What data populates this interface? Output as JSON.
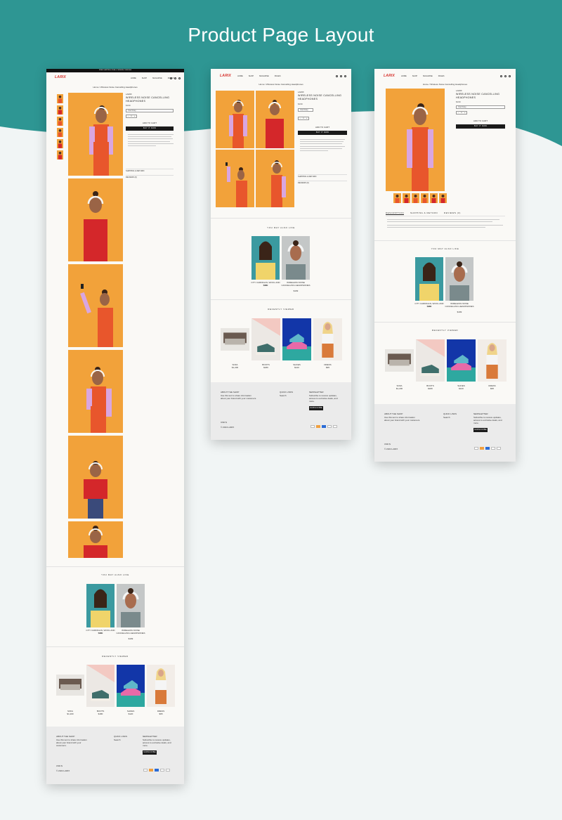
{
  "page": {
    "headline": "Product Page Layout"
  },
  "colors": {
    "teal": "#2e9693",
    "orange": "#f2a23a",
    "store_red": "#d6302b",
    "dark": "#1a1a1a"
  },
  "store": {
    "logo": "LARIX",
    "announcement": "FREE SHIPPING ON ALL ORDERS OVER $50",
    "nav": [
      "HOME",
      "SHOP",
      "MAGAZINE",
      "PAGES"
    ],
    "breadcrumb": "Home / Wireless Noise Cancelling Headphones",
    "product_title": "WIRELESS NOISE CANCELLING HEADPHONES",
    "vendor": "LARIX",
    "price": "$199",
    "option_value": "Cool Grey",
    "qty_minus": "−",
    "qty_value": "1",
    "qty_plus": "+",
    "add_to_cart": "ADD TO CART",
    "buy_now": "BUY IT NOW",
    "accordion": [
      "SHIPPING & RETURN",
      "REVIEWS (0)"
    ],
    "tabs": [
      "DESCRIPTION",
      "SHIPPING & RETURN",
      "REVIEWS (0)"
    ],
    "you_may_also_like": "YOU MAY ALSO LIKE",
    "recently_viewed": "RECENTLY VIEWED",
    "rel1_name": "CITY CARDIGAN, WOOL AND YAK",
    "rel1_price": "$150",
    "rel2_name": "WIRELESS NOISE CANCELLING HEADPHONES",
    "rel2_price": "$199",
    "recent": [
      {
        "name": "SOFA",
        "price": "$1,200"
      },
      {
        "name": "BOOTS",
        "price": "$180"
      },
      {
        "name": "SHOES",
        "price": "$120"
      },
      {
        "name": "DRESS",
        "price": "$95"
      }
    ],
    "footer": {
      "about_title": "ABOUT THE SHOP",
      "about_text": "Use this text to share information about your brand with your customers.",
      "quick_title": "QUICK LINKS",
      "quick_link": "Search",
      "newsletter_title": "NEWSLETTER",
      "newsletter_text": "Subscribe to receive updates, access to exclusive deals, and more.",
      "subscribe": "SUBSCRIBE",
      "copyright": "© 2024 LARIX",
      "currency": "USD $"
    }
  }
}
